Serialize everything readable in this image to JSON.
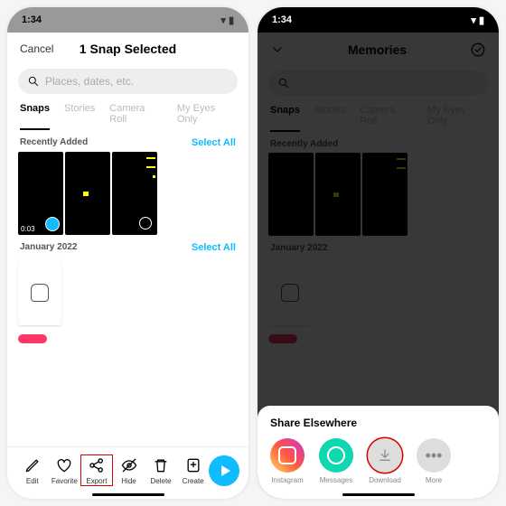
{
  "left": {
    "time": "1:34",
    "cancel": "Cancel",
    "title": "1 Snap Selected",
    "search_placeholder": "Places, dates, etc.",
    "tabs": [
      "Snaps",
      "Stories",
      "Camera Roll",
      "My Eyes Only"
    ],
    "sections": {
      "recent_label": "Recently Added",
      "recent_selectall": "Select All",
      "ts1": "0:03",
      "jan_label": "January 2022",
      "jan_selectall": "Select All"
    },
    "actions": [
      "Edit",
      "Favorite",
      "Export",
      "Hide",
      "Delete",
      "Create"
    ]
  },
  "right": {
    "time": "1:34",
    "title": "Memories",
    "search_placeholder": "",
    "tabs": [
      "Snaps",
      "Stories",
      "Camera Roll",
      "My Eyes Only"
    ],
    "recent_label": "Recently Added",
    "jan_label": "January 2022",
    "sheet_title": "Share Elsewhere",
    "share": [
      "Instagram",
      "Messages",
      "Download",
      "More"
    ]
  }
}
